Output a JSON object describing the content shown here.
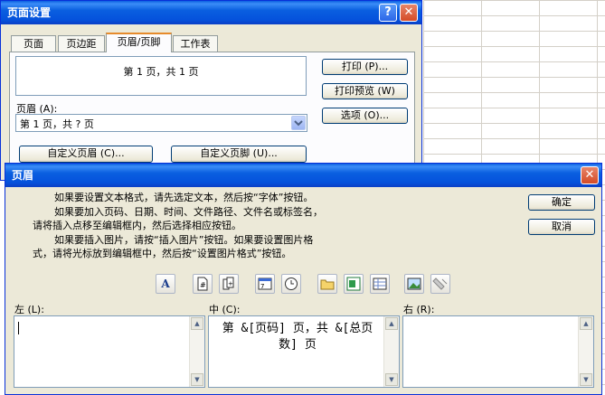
{
  "page_setup": {
    "title": "页面设置",
    "help_glyph": "?",
    "close_glyph": "✕",
    "tabs": [
      "页面",
      "页边距",
      "页眉/页脚",
      "工作表"
    ],
    "preview_text": "第 1 页，共 1 页",
    "header_label": "页眉 (A):",
    "header_value": "第 1 页，共 ? 页",
    "buttons": {
      "print": "打印 (P)...",
      "print_preview": "打印预览 (W)",
      "options": "选项 (O)...",
      "custom_header": "自定义页眉 (C)...",
      "custom_footer": "自定义页脚 (U)..."
    }
  },
  "header_dialog": {
    "title": "页眉",
    "close_glyph": "✕",
    "instructions": [
      "如果要设置文本格式，请先选定文本，然后按“字体”按钮。",
      "如果要加入页码、日期、时间、文件路径、文件名或标签名，",
      "请将插入点移至编辑框内，然后选择相应按钮。",
      "如果要插入图片，请按“插入图片”按钮。如果要设置图片格",
      "式，请将光标放到编辑框中，然后按“设置图片格式”按钮。"
    ],
    "ok": "确定",
    "cancel": "取消",
    "left_label": "左 (L):",
    "center_label": "中 (C):",
    "right_label": "右 (R):",
    "left_value": "",
    "center_value": "第 &[页码] 页，共 &[总页数] 页",
    "right_value": ""
  },
  "toolbar_icons": [
    "font-icon",
    "page-number-icon",
    "total-pages-icon",
    "date-icon",
    "time-icon",
    "file-path-icon",
    "file-name-icon",
    "sheet-name-icon",
    "insert-picture-icon",
    "format-picture-icon"
  ]
}
